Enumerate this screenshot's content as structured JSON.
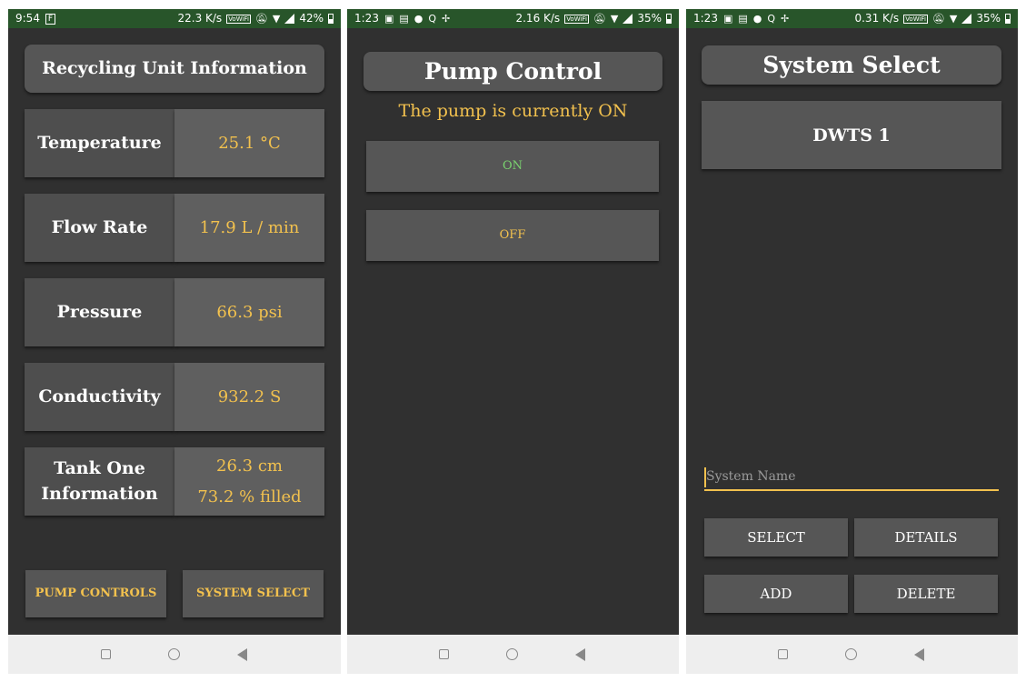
{
  "screen1": {
    "status": {
      "time": "9:54",
      "speed": "22.3 K/s",
      "wifi_tag": "VoWiFi",
      "battery": "42%"
    },
    "title": "Recycling Unit Information",
    "rows": [
      {
        "label": "Temperature",
        "value": "25.1 °C"
      },
      {
        "label": "Flow Rate",
        "value": "17.9 L / min"
      },
      {
        "label": "Pressure",
        "value": "66.3 psi"
      },
      {
        "label": "Conductivity",
        "value": "932.2 S"
      }
    ],
    "tank": {
      "label": "Tank One Information",
      "value1": "26.3 cm",
      "value2": "73.2 % filled"
    },
    "buttons": {
      "pump_controls": "PUMP CONTROLS",
      "system_select": "SYSTEM SELECT"
    }
  },
  "screen2": {
    "status": {
      "time": "1:23",
      "speed": "2.16 K/s",
      "wifi_tag": "VoWiFi",
      "battery": "35%"
    },
    "title": "Pump Control",
    "state_text": "The pump is currently ON",
    "buttons": {
      "on": "ON",
      "off": "OFF"
    }
  },
  "screen3": {
    "status": {
      "time": "1:23",
      "speed": "0.31 K/s",
      "wifi_tag": "VoWiFi",
      "battery": "35%"
    },
    "title": "System Select",
    "systems": [
      "DWTS 1"
    ],
    "input": {
      "placeholder": "System Name",
      "value": ""
    },
    "buttons": {
      "select": "SELECT",
      "details": "DETAILS",
      "add": "ADD",
      "delete": "DELETE"
    }
  },
  "colors": {
    "accent": "#f2c14e",
    "background": "#303030",
    "statusbar": "#28552a",
    "on_green": "#7ad36f"
  }
}
